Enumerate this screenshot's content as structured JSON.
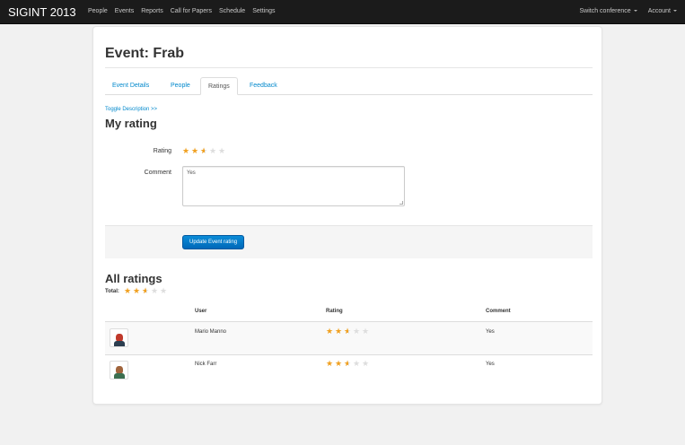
{
  "navbar": {
    "brand": "SIGINT 2013",
    "items": [
      "People",
      "Events",
      "Reports",
      "Call for Papers",
      "Schedule",
      "Settings"
    ],
    "switch_conference": "Switch conference",
    "account": "Account"
  },
  "page": {
    "title": "Event: Frab",
    "tabs": [
      "Event Details",
      "People",
      "Ratings",
      "Feedback"
    ],
    "active_tab": "Ratings",
    "toggle_description": "Toggle Description >>"
  },
  "my_rating": {
    "heading": "My rating",
    "rating_label": "Rating",
    "rating": 2.5,
    "rating_max": 5,
    "comment_label": "Comment",
    "comment_value": "Yes",
    "submit_label": "Update Event rating"
  },
  "all_ratings": {
    "heading": "All ratings",
    "total_label": "Total:",
    "total": 2.5,
    "columns": [
      "User",
      "Rating",
      "Comment"
    ],
    "rows": [
      {
        "user": "Mario Manno",
        "rating": 2.5,
        "comment": "Yes"
      },
      {
        "user": "Nick Farr",
        "rating": 2.5,
        "comment": "Yes"
      }
    ]
  },
  "colors": {
    "navbar_bg": "#1b1b1b",
    "link": "#0088cc",
    "star_on": "#f0a020",
    "star_off": "#dddddd",
    "button": "#0074cc"
  }
}
